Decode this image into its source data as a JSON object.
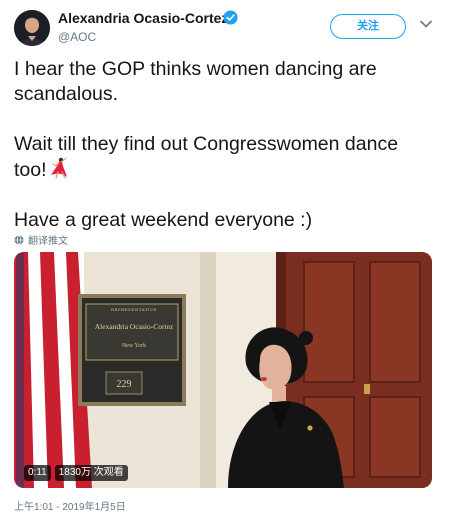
{
  "author": {
    "name": "Alexandria Ocasio-Cortez",
    "handle": "@AOC",
    "verified": true,
    "avatar_icon": "profile-photo"
  },
  "follow_button_label": "关注",
  "tweet": {
    "line_1": "I hear the GOP thinks women dancing are scandalous.",
    "line_2": "Wait till they find out Congresswomen dance too!",
    "emoji": "woman-dancing-emoji",
    "line_3": "Have a great weekend everyone :)"
  },
  "translate_label": "翻译推文",
  "media": {
    "plaque_header": "REPRESENTATIVE",
    "plaque_name": "Alexandria Ocasio-Cortez",
    "plaque_state": "New York",
    "room_number": "229",
    "video_duration": "0:11",
    "video_views": "1830万 次观看"
  },
  "timestamp": "上午1:01 - 2019年1月5日",
  "colors": {
    "accent": "#1da1f2",
    "text_primary": "#14171a",
    "text_secondary": "#657786"
  }
}
